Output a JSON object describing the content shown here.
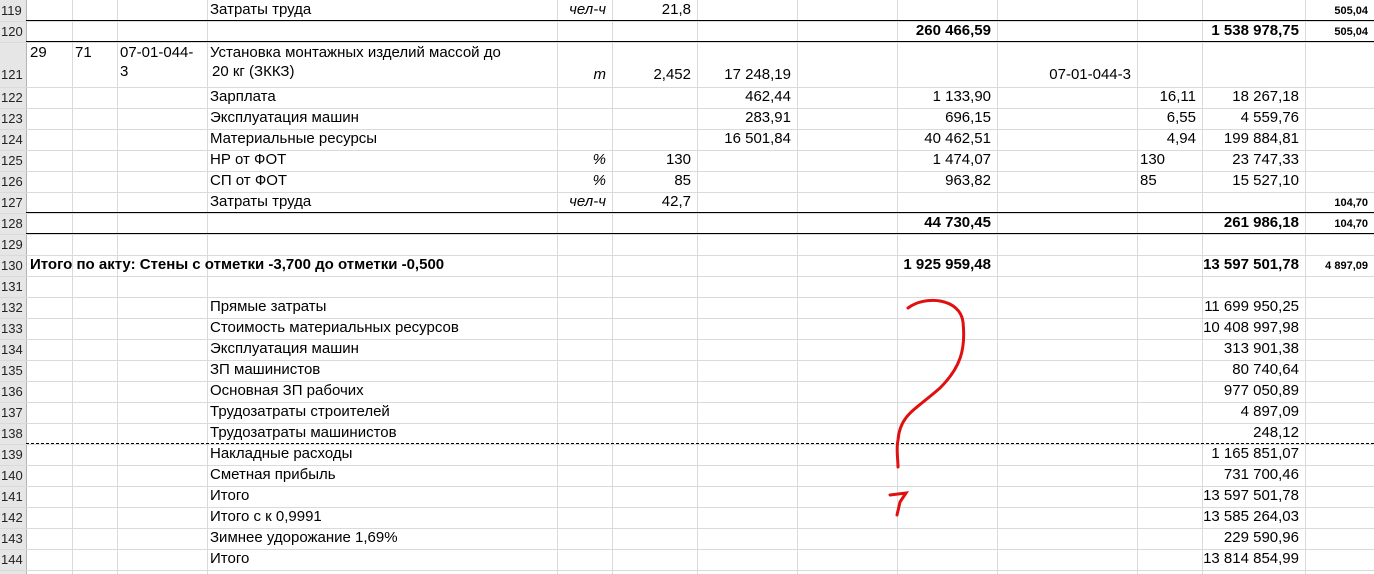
{
  "rows": [
    {
      "n": "119",
      "c": [
        {
          "t": "Затраты труда",
          "col": "D"
        },
        {
          "t": "чел-ч",
          "col": "E",
          "i": true
        },
        {
          "t": "21,8",
          "col": "F"
        },
        {
          "t": "505,04",
          "col": "M",
          "sm": true
        }
      ]
    },
    {
      "n": "120",
      "c": [
        {
          "t": "260 466,59",
          "col": "I",
          "b": true
        },
        {
          "t": "1 538 978,75",
          "col": "L",
          "b": true
        },
        {
          "t": "505,04",
          "col": "M",
          "sm": true
        }
      ]
    },
    {
      "n": "121",
      "c": [
        {
          "t": "29",
          "col": "A"
        },
        {
          "t": "71",
          "col": "B"
        },
        {
          "t": "07-01-044-",
          "col": "C"
        },
        {
          "t": "Установка монтажных изделий массой до",
          "col": "D"
        },
        {
          "t": "m",
          "col": "E",
          "i": true
        },
        {
          "t": "2,452",
          "col": "F"
        },
        {
          "t": "17 248,19",
          "col": "G"
        },
        {
          "t": "07-01-044-3",
          "col": "J"
        }
      ]
    },
    {
      "n": "122",
      "c": [
        {
          "t": "Зарплата",
          "col": "D"
        },
        {
          "t": "462,44",
          "col": "G"
        },
        {
          "t": "1 133,90",
          "col": "I"
        },
        {
          "t": "16,11",
          "col": "K"
        },
        {
          "t": "18 267,18",
          "col": "L"
        }
      ]
    },
    {
      "n": "123",
      "c": [
        {
          "t": "Эксплуатация машин",
          "col": "D"
        },
        {
          "t": "283,91",
          "col": "G"
        },
        {
          "t": "696,15",
          "col": "I"
        },
        {
          "t": "6,55",
          "col": "K"
        },
        {
          "t": "4 559,76",
          "col": "L"
        }
      ]
    },
    {
      "n": "124",
      "c": [
        {
          "t": "Материальные ресурсы",
          "col": "D"
        },
        {
          "t": "16 501,84",
          "col": "G"
        },
        {
          "t": "40 462,51",
          "col": "I"
        },
        {
          "t": "4,94",
          "col": "K"
        },
        {
          "t": "199 884,81",
          "col": "L"
        }
      ]
    },
    {
      "n": "125",
      "c": [
        {
          "t": "НР от ФОТ",
          "col": "D"
        },
        {
          "t": "%",
          "col": "E",
          "i": true
        },
        {
          "t": "130",
          "col": "F"
        },
        {
          "t": "1 474,07",
          "col": "I"
        },
        {
          "t": "130",
          "col": "Kl"
        },
        {
          "t": "23 747,33",
          "col": "L"
        }
      ]
    },
    {
      "n": "126",
      "c": [
        {
          "t": "СП от ФОТ",
          "col": "D"
        },
        {
          "t": "%",
          "col": "E",
          "i": true
        },
        {
          "t": "85",
          "col": "F"
        },
        {
          "t": "963,82",
          "col": "I"
        },
        {
          "t": "85",
          "col": "Kl"
        },
        {
          "t": "15 527,10",
          "col": "L"
        }
      ]
    },
    {
      "n": "127",
      "c": [
        {
          "t": "Затраты труда",
          "col": "D"
        },
        {
          "t": "чел-ч",
          "col": "E",
          "i": true
        },
        {
          "t": "42,7",
          "col": "F"
        },
        {
          "t": "104,70",
          "col": "M",
          "sm": true
        }
      ]
    },
    {
      "n": "128",
      "c": [
        {
          "t": "44 730,45",
          "col": "I",
          "b": true
        },
        {
          "t": "261 986,18",
          "col": "L",
          "b": true
        },
        {
          "t": "104,70",
          "col": "M",
          "sm": true
        }
      ]
    },
    {
      "n": "129",
      "c": []
    },
    {
      "n": "130",
      "c": [
        {
          "t": "Итого по акту: Стены с отметки -3,700 до отметки -0,500",
          "col": "A",
          "b": true
        },
        {
          "t": "1 925 959,48",
          "col": "I",
          "b": true
        },
        {
          "t": "13 597 501,78",
          "col": "L",
          "b": true
        },
        {
          "t": "4 897,09",
          "col": "M",
          "sm": true
        }
      ]
    },
    {
      "n": "131",
      "c": []
    },
    {
      "n": "132",
      "c": [
        {
          "t": "Прямые затраты",
          "col": "D"
        },
        {
          "t": "11 699 950,25",
          "col": "L"
        }
      ]
    },
    {
      "n": "133",
      "c": [
        {
          "t": "Стоимость материальных ресурсов",
          "col": "D"
        },
        {
          "t": "10 408 997,98",
          "col": "L"
        }
      ]
    },
    {
      "n": "134",
      "c": [
        {
          "t": "Эксплуатация машин",
          "col": "D"
        },
        {
          "t": "313 901,38",
          "col": "L"
        }
      ]
    },
    {
      "n": "135",
      "c": [
        {
          "t": "ЗП машинистов",
          "col": "D"
        },
        {
          "t": "80 740,64",
          "col": "L"
        }
      ]
    },
    {
      "n": "136",
      "c": [
        {
          "t": "Основная ЗП рабочих",
          "col": "D"
        },
        {
          "t": "977 050,89",
          "col": "L"
        }
      ]
    },
    {
      "n": "137",
      "c": [
        {
          "t": "Трудозатраты строителей",
          "col": "D"
        },
        {
          "t": "4 897,09",
          "col": "L"
        }
      ]
    },
    {
      "n": "138",
      "c": [
        {
          "t": "Трудозатраты машинистов",
          "col": "D"
        },
        {
          "t": "248,12",
          "col": "L"
        }
      ]
    },
    {
      "n": "139",
      "c": [
        {
          "t": "Накладные расходы",
          "col": "D"
        },
        {
          "t": "1 165 851,07",
          "col": "L"
        }
      ]
    },
    {
      "n": "140",
      "c": [
        {
          "t": "Сметная прибыль",
          "col": "D"
        },
        {
          "t": "731 700,46",
          "col": "L"
        }
      ]
    },
    {
      "n": "141",
      "c": [
        {
          "t": "Итого",
          "col": "D"
        },
        {
          "t": "13 597 501,78",
          "col": "L"
        }
      ]
    },
    {
      "n": "142",
      "c": [
        {
          "t": "Итого с к 0,9991",
          "col": "D"
        },
        {
          "t": "13 585 264,03",
          "col": "L"
        }
      ]
    },
    {
      "n": "143",
      "c": [
        {
          "t": "Зимнее удорожание 1,69%",
          "col": "D"
        },
        {
          "t": "229 590,96",
          "col": "L"
        }
      ]
    },
    {
      "n": "144",
      "c": [
        {
          "t": "Итого",
          "col": "D"
        },
        {
          "t": "13 814 854,99",
          "col": "L"
        }
      ]
    }
  ],
  "extra_lines": {
    "row121_c_line2": "3",
    "row121_d_line2": "20 кг (ЗККЗ)",
    "row121_n_label": "121"
  },
  "annotation": {
    "icon": "question-mark-icon",
    "color": "#e01010"
  }
}
